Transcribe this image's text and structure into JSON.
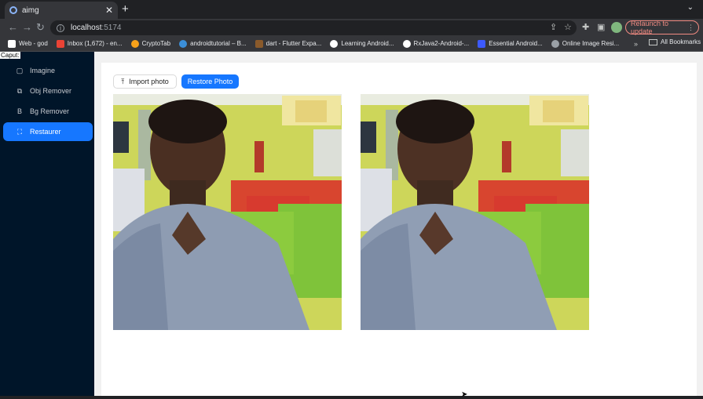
{
  "browser": {
    "tab_title": "aimg",
    "new_tab": "+",
    "url_host": "localhost",
    "url_port": ":5174",
    "relaunch_label": "Relaunch to update",
    "bookmarks": [
      {
        "label": "Web - god",
        "icon_color": "#ffffff"
      },
      {
        "label": "Inbox (1,672) - en...",
        "icon_color": "#ea4335"
      },
      {
        "label": "CryptoTab",
        "icon_color": "#f7a11a"
      },
      {
        "label": "androidtutorial – B...",
        "icon_color": "#3b8fd8"
      },
      {
        "label": "dart - Flutter Expa...",
        "icon_color": "#8a5a2b"
      },
      {
        "label": "Learning Android...",
        "icon_color": "#ffffff"
      },
      {
        "label": "RxJava2-Android-...",
        "icon_color": "#ffffff"
      },
      {
        "label": "Essential Android...",
        "icon_color": "#3d5afe"
      },
      {
        "label": "Online Image Resi...",
        "icon_color": "#9aa0a6"
      }
    ],
    "bookmarks_more": "»",
    "all_bookmarks": "All Bookmarks"
  },
  "app": {
    "brand": "Caput:",
    "menu": [
      {
        "label": "Imagine",
        "icon": "image-icon",
        "glyph": "▢",
        "active": false
      },
      {
        "label": "Obj Remover",
        "icon": "object-icon",
        "glyph": "⧉",
        "active": false
      },
      {
        "label": "Bg Remover",
        "icon": "bg-remover-icon",
        "glyph": "B",
        "active": false
      },
      {
        "label": "Restaurer",
        "icon": "restore-icon",
        "glyph": "⛶",
        "active": true
      }
    ],
    "import_label": "Import photo",
    "restore_label": "Restore Photo",
    "photos": [
      {
        "name": "original-photo"
      },
      {
        "name": "restored-photo"
      }
    ]
  },
  "colors": {
    "sidebar_bg": "#001529",
    "accent": "#1677ff"
  }
}
